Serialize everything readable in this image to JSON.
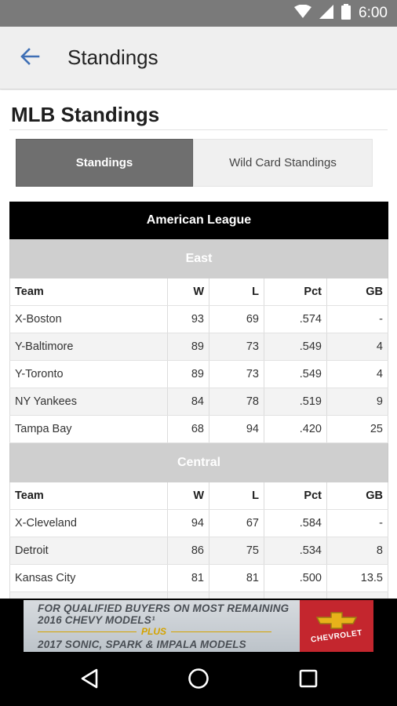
{
  "status_bar": {
    "time": "6:00",
    "icons": [
      "wifi-icon",
      "signal-icon",
      "battery-icon"
    ]
  },
  "app_bar": {
    "title": "Standings",
    "back_icon": "arrow-left-icon"
  },
  "page": {
    "title": "MLB Standings"
  },
  "tabs": [
    {
      "label": "Standings",
      "active": true
    },
    {
      "label": "Wild Card Standings",
      "active": false
    }
  ],
  "league": {
    "name": "American League",
    "columns": [
      "Team",
      "W",
      "L",
      "Pct",
      "GB"
    ],
    "divisions": [
      {
        "name": "East",
        "rows": [
          [
            "X-Boston",
            "93",
            "69",
            ".574",
            "-"
          ],
          [
            "Y-Baltimore",
            "89",
            "73",
            ".549",
            "4"
          ],
          [
            "Y-Toronto",
            "89",
            "73",
            ".549",
            "4"
          ],
          [
            "NY Yankees",
            "84",
            "78",
            ".519",
            "9"
          ],
          [
            "Tampa Bay",
            "68",
            "94",
            ".420",
            "25"
          ]
        ]
      },
      {
        "name": "Central",
        "rows": [
          [
            "X-Cleveland",
            "94",
            "67",
            ".584",
            "-"
          ],
          [
            "Detroit",
            "86",
            "75",
            ".534",
            "8"
          ],
          [
            "Kansas City",
            "81",
            "81",
            ".500",
            "13.5"
          ]
        ]
      }
    ]
  },
  "ad": {
    "line1": "FOR QUALIFIED BUYERS ON MOST REMAINING",
    "line2": "2016 CHEVY MODELS¹",
    "plus": "PLUS",
    "line3": "2017 SONIC, SPARK & IMPALA MODELS",
    "brand": "CHEVROLET",
    "colors": {
      "brand_red": "#c4262e",
      "bowtie_gold": "#e8b21a",
      "plus_gold": "#d4a300"
    }
  },
  "nav": {
    "icons": [
      "back-triangle-icon",
      "home-circle-icon",
      "recents-square-icon"
    ]
  },
  "colors": {
    "accent_blue": "#3f6fb5",
    "active_tab": "#6f6f6f",
    "league_header": "#000000",
    "division_header": "#cfcfcf"
  }
}
